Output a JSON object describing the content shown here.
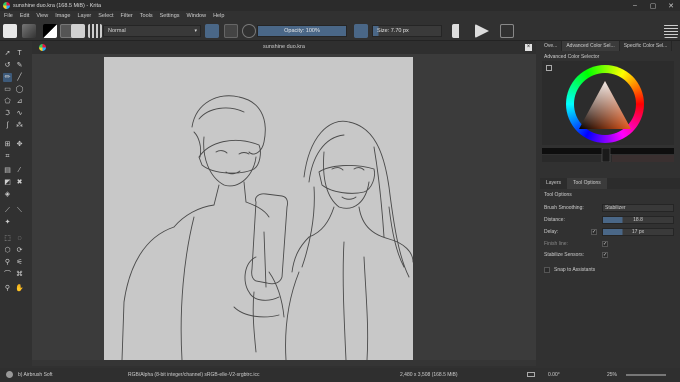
{
  "window": {
    "title": "sunshine duo.kra (168.5 MiB)  - Krita"
  },
  "menu": [
    "File",
    "Edit",
    "View",
    "Image",
    "Layer",
    "Select",
    "Filter",
    "Tools",
    "Settings",
    "Window",
    "Help"
  ],
  "toolbar": {
    "blend_mode": "Normal",
    "opacity_label": "Opacity: 100%",
    "size_label": "Size: 7.70 px"
  },
  "document": {
    "tab_title": "sunshine duo.kra",
    "close_label": "×"
  },
  "right_panel": {
    "tabs": [
      "Ove...",
      "Advanced Color Sel...",
      "Specific Color Sel..."
    ],
    "selector_label": "Advanced Color Selector",
    "lower_tabs": [
      "Layers",
      "Tool Options"
    ],
    "tool_options_label": "Tool Options",
    "options": {
      "brush_smoothing_label": "Brush Smoothing:",
      "brush_smoothing_value": "Stabilizer",
      "distance_label": "Distance:",
      "distance_value": "18.8",
      "delay_label": "Delay:",
      "delay_value": "17 px",
      "finish_line_label": "Finish line:",
      "stabilize_sensors_label": "Stabilize Sensors:",
      "snap_label": "Snap to Assistants"
    }
  },
  "status": {
    "brush": "b) Airbrush Soft",
    "color_profile": "RGB/Alpha (8-bit integer/channel)  sRGB-elle-V2-srgbtrc.icc",
    "dimensions": "2,480 x 3,508 (168.5 MiB)",
    "rotation": "0.00°",
    "zoom": "25%"
  },
  "colors": {
    "accent": "#4a6787",
    "background": "#313131",
    "canvas": "#c8c8c8"
  }
}
